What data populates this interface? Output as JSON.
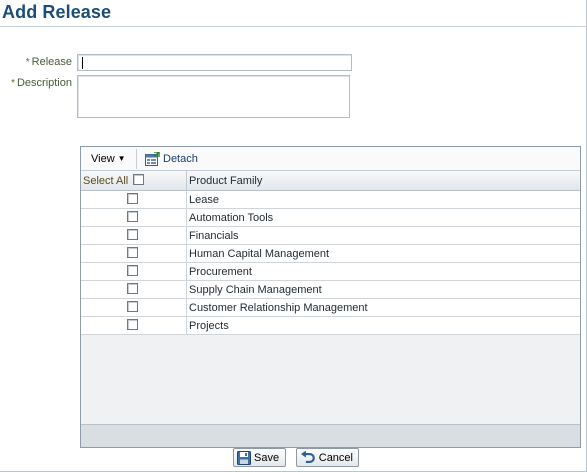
{
  "page": {
    "title": "Add Release"
  },
  "form": {
    "release": {
      "required_marker": "*",
      "label": "Release",
      "value": ""
    },
    "description": {
      "required_marker": "*",
      "label": "Description",
      "value": ""
    }
  },
  "table": {
    "toolbar": {
      "view_label": "View",
      "view_arrow": "▼",
      "detach_label": "Detach"
    },
    "columns": {
      "select_all": "Select All",
      "product_family": "Product Family"
    },
    "rows": [
      {
        "product_family": "Lease"
      },
      {
        "product_family": "Automation Tools"
      },
      {
        "product_family": "Financials"
      },
      {
        "product_family": "Human Capital Management"
      },
      {
        "product_family": "Procurement"
      },
      {
        "product_family": "Supply Chain Management"
      },
      {
        "product_family": "Customer Relationship Management"
      },
      {
        "product_family": "Projects"
      }
    ]
  },
  "actions": {
    "save_label": "Save",
    "cancel_label": "Cancel"
  },
  "colors": {
    "title": "#1a4d7a",
    "label": "#4a5a3c",
    "link": "#1a3d6e"
  }
}
